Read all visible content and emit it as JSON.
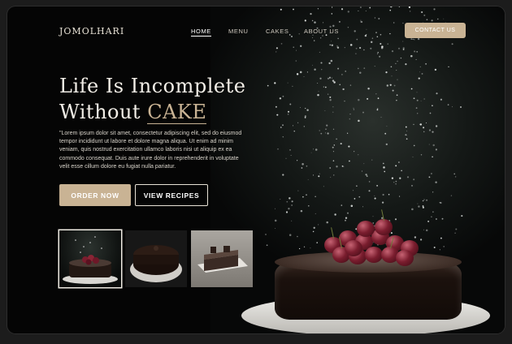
{
  "brand": {
    "name": "JOMOLHARI"
  },
  "nav": {
    "items": [
      {
        "label": "HOME",
        "active": true
      },
      {
        "label": "MENU",
        "active": false
      },
      {
        "label": "CAKES",
        "active": false
      },
      {
        "label": "ABOUT US",
        "active": false
      }
    ],
    "contact_label": "CONTACT US"
  },
  "hero": {
    "headline_line1": "Life Is Incomplete",
    "headline_line2_prefix": "Without ",
    "headline_accent": "CAKE",
    "body": "\"Lorem ipsum dolor sit amet, consectetur adipiscing elit, sed do eiusmod tempor incididunt ut labore et dolore magna aliqua. Ut enim ad minim veniam, quis nostrud exercitation ullamco laboris nisi ut aliquip ex ea commodo consequat. Duis aute irure dolor in reprehenderit in voluptate velit esse cillum dolore eu fugiat nulla pariatur.",
    "order_label": "ORDER NOW",
    "recipes_label": "VIEW RECIPES"
  },
  "thumbnails": [
    {
      "name": "cherry-cake-thumb",
      "selected": true
    },
    {
      "name": "chocolate-cake-thumb",
      "selected": false
    },
    {
      "name": "square-cake-thumb",
      "selected": false
    }
  ],
  "colors": {
    "accent": "#c9b394",
    "background": "#050505",
    "text": "#f2eee7"
  }
}
